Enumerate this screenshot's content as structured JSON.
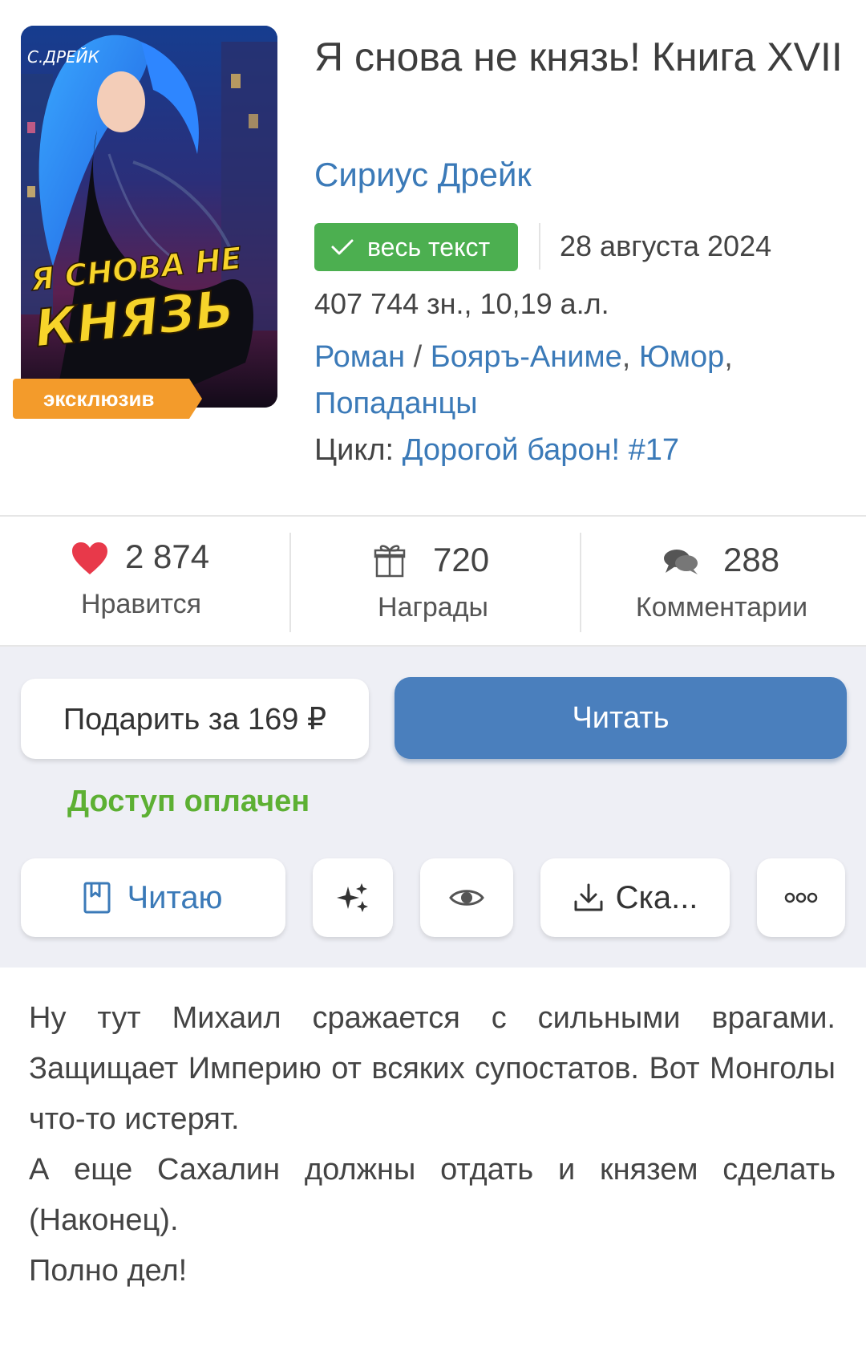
{
  "book": {
    "title": "Я снова не князь! Книга XVII",
    "author": "Сириус Дрейк",
    "status_badge": "весь текст",
    "date": "28 августа 2024",
    "size": "407 744 зн., 10,19 а.л.",
    "genres": {
      "form": "Роман",
      "separator": "/",
      "items": [
        "Бояръ-Аниме",
        "Юмор",
        "Попаданцы"
      ]
    },
    "cycle_label": "Цикл:",
    "cycle_name": "Дорогой барон! #17",
    "cover": {
      "author_text": "С.ДРЕЙК",
      "title_line1": "Я СНОВА НЕ",
      "title_line2": "КНЯЗЬ",
      "exclusive_label": "эксклюзив"
    }
  },
  "stats": {
    "likes": {
      "value": "2 874",
      "label": "Нравится",
      "icon": "heart-icon"
    },
    "awards": {
      "value": "720",
      "label": "Награды",
      "icon": "gift-icon"
    },
    "comments": {
      "value": "288",
      "label": "Комментарии",
      "icon": "comments-icon"
    }
  },
  "actions": {
    "gift_label": "Подарить за 169 ₽",
    "read_label": "Читать",
    "access_status": "Доступ оплачен",
    "reading_label": "Читаю",
    "download_label": "Ска..."
  },
  "description": [
    "Ну тут Михаил сражается с сильными врагами. Защищает Империю от всяких супостатов. Вот Монголы что-то истерят.",
    "А еще Сахалин должны отдать и князем сделать (Наконец).",
    "Полно дел!"
  ],
  "colors": {
    "link": "#3b7ab8",
    "badge_green": "#4caf50",
    "access_green": "#5db033",
    "primary_button": "#4a7fbd",
    "exclusive_orange": "#f39b2b",
    "heart_red": "#e8394a"
  }
}
